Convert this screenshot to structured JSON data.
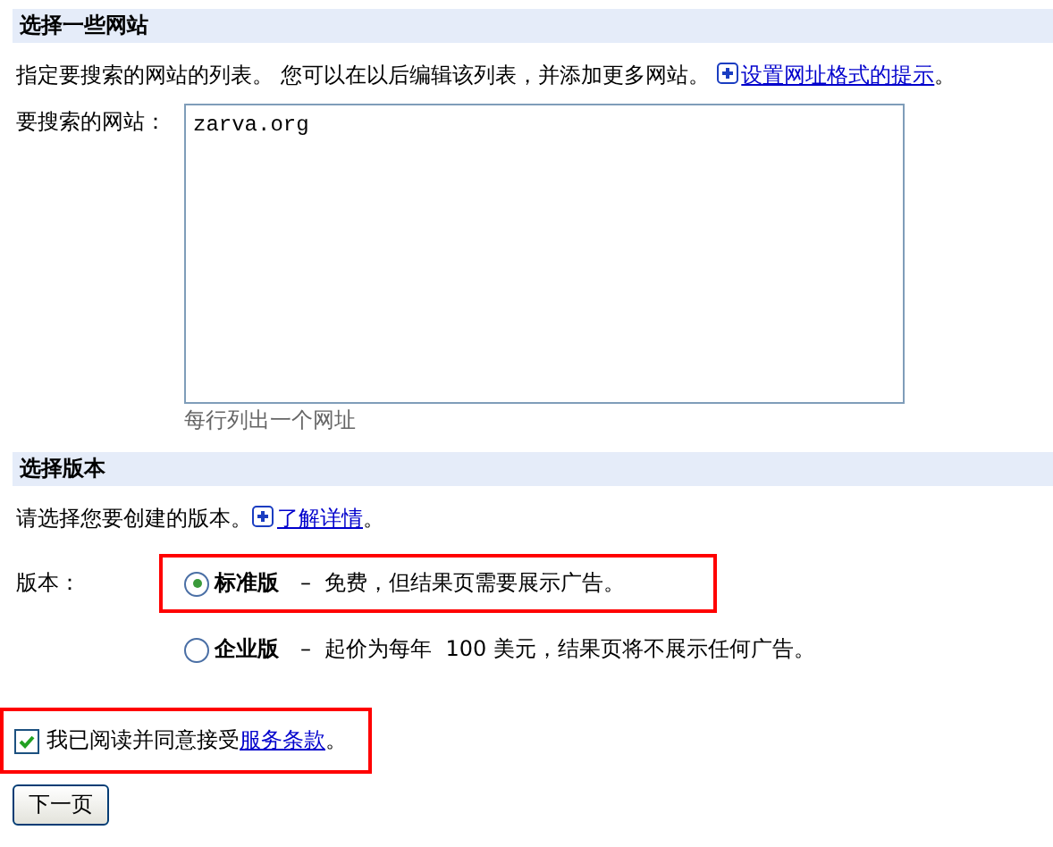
{
  "sites_section": {
    "title": "选择一些网站",
    "description": "指定要搜索的网站的列表。 您可以在以后编辑该列表，并添加更多网站。",
    "tip_link": "设置网址格式的提示",
    "tip_end": "。",
    "field_label": "要搜索的网站：",
    "sites_value": "zarva.org",
    "hint": "每行列出一个网址"
  },
  "edition_section": {
    "title": "选择版本",
    "description": "请选择您要创建的版本。",
    "details_link": "了解详情",
    "details_end": "。",
    "label": "版本：",
    "editions": [
      {
        "name": "标准版",
        "description": "–  免费，但结果页需要展示广告。",
        "selected": true,
        "highlighted": true
      },
      {
        "name": "企业版",
        "description": "–  起价为每年  100 美元，结果页将不展示任何广告。",
        "selected": false,
        "highlighted": false
      }
    ]
  },
  "terms": {
    "checked": true,
    "highlighted": true,
    "text": "我已阅读并同意接受",
    "link": "服务条款",
    "end": "。"
  },
  "next_button": "下一页"
}
